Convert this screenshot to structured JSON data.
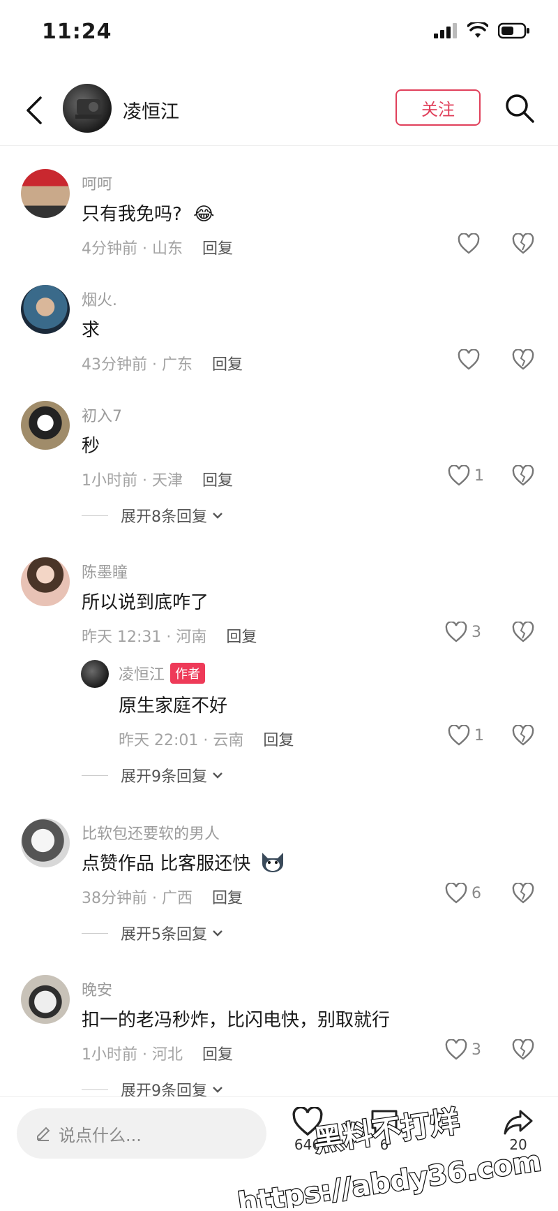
{
  "status_bar": {
    "time": "11:24"
  },
  "header": {
    "title": "凌恒江",
    "follow_label": "关注"
  },
  "comments": [
    {
      "name": "呵呵",
      "text": "只有我免吗?",
      "emoji": "😂",
      "time_location": "4分钟前 · 山东",
      "reply_label": "回复",
      "likes": ""
    },
    {
      "name": "烟火.",
      "text": "求",
      "time_location": "43分钟前 · 广东",
      "reply_label": "回复",
      "likes": ""
    },
    {
      "name": "初入7",
      "text": "秒",
      "time_location": "1小时前 · 天津",
      "reply_label": "回复",
      "likes": "1",
      "expand": "展开8条回复"
    },
    {
      "name": "陈墨瞳",
      "text": "所以说到底咋了",
      "time_location": "昨天 12:31 · 河南",
      "reply_label": "回复",
      "likes": "3",
      "sub_reply": {
        "name": "凌恒江",
        "tag": "作者",
        "text": "原生家庭不好",
        "time_location": "昨天 22:01 · 云南",
        "reply_label": "回复",
        "likes": "1"
      },
      "expand": "展开9条回复"
    },
    {
      "name": "比软包还要软的男人",
      "text": "点赞作品 比客服还快",
      "time_location": "38分钟前 · 广西",
      "reply_label": "回复",
      "likes": "6",
      "expand": "展开5条回复"
    },
    {
      "name": "晚安",
      "text": "扣一的老冯秒炸，比闪电快，别取就行",
      "time_location": "1小时前 · 河北",
      "reply_label": "回复",
      "likes": "3",
      "expand": "展开9条回复"
    }
  ],
  "bottom_bar": {
    "input_placeholder": "说点什么...",
    "like_count": "646",
    "comment_count": "6",
    "share_count": "20"
  },
  "watermark": {
    "line1": "黑料不打烊",
    "line2": "https://abdy36.com"
  },
  "colors": {
    "accent": "#e0405b",
    "author_tag": "#ee3a58",
    "secondary_text": "#9b9b9b"
  }
}
